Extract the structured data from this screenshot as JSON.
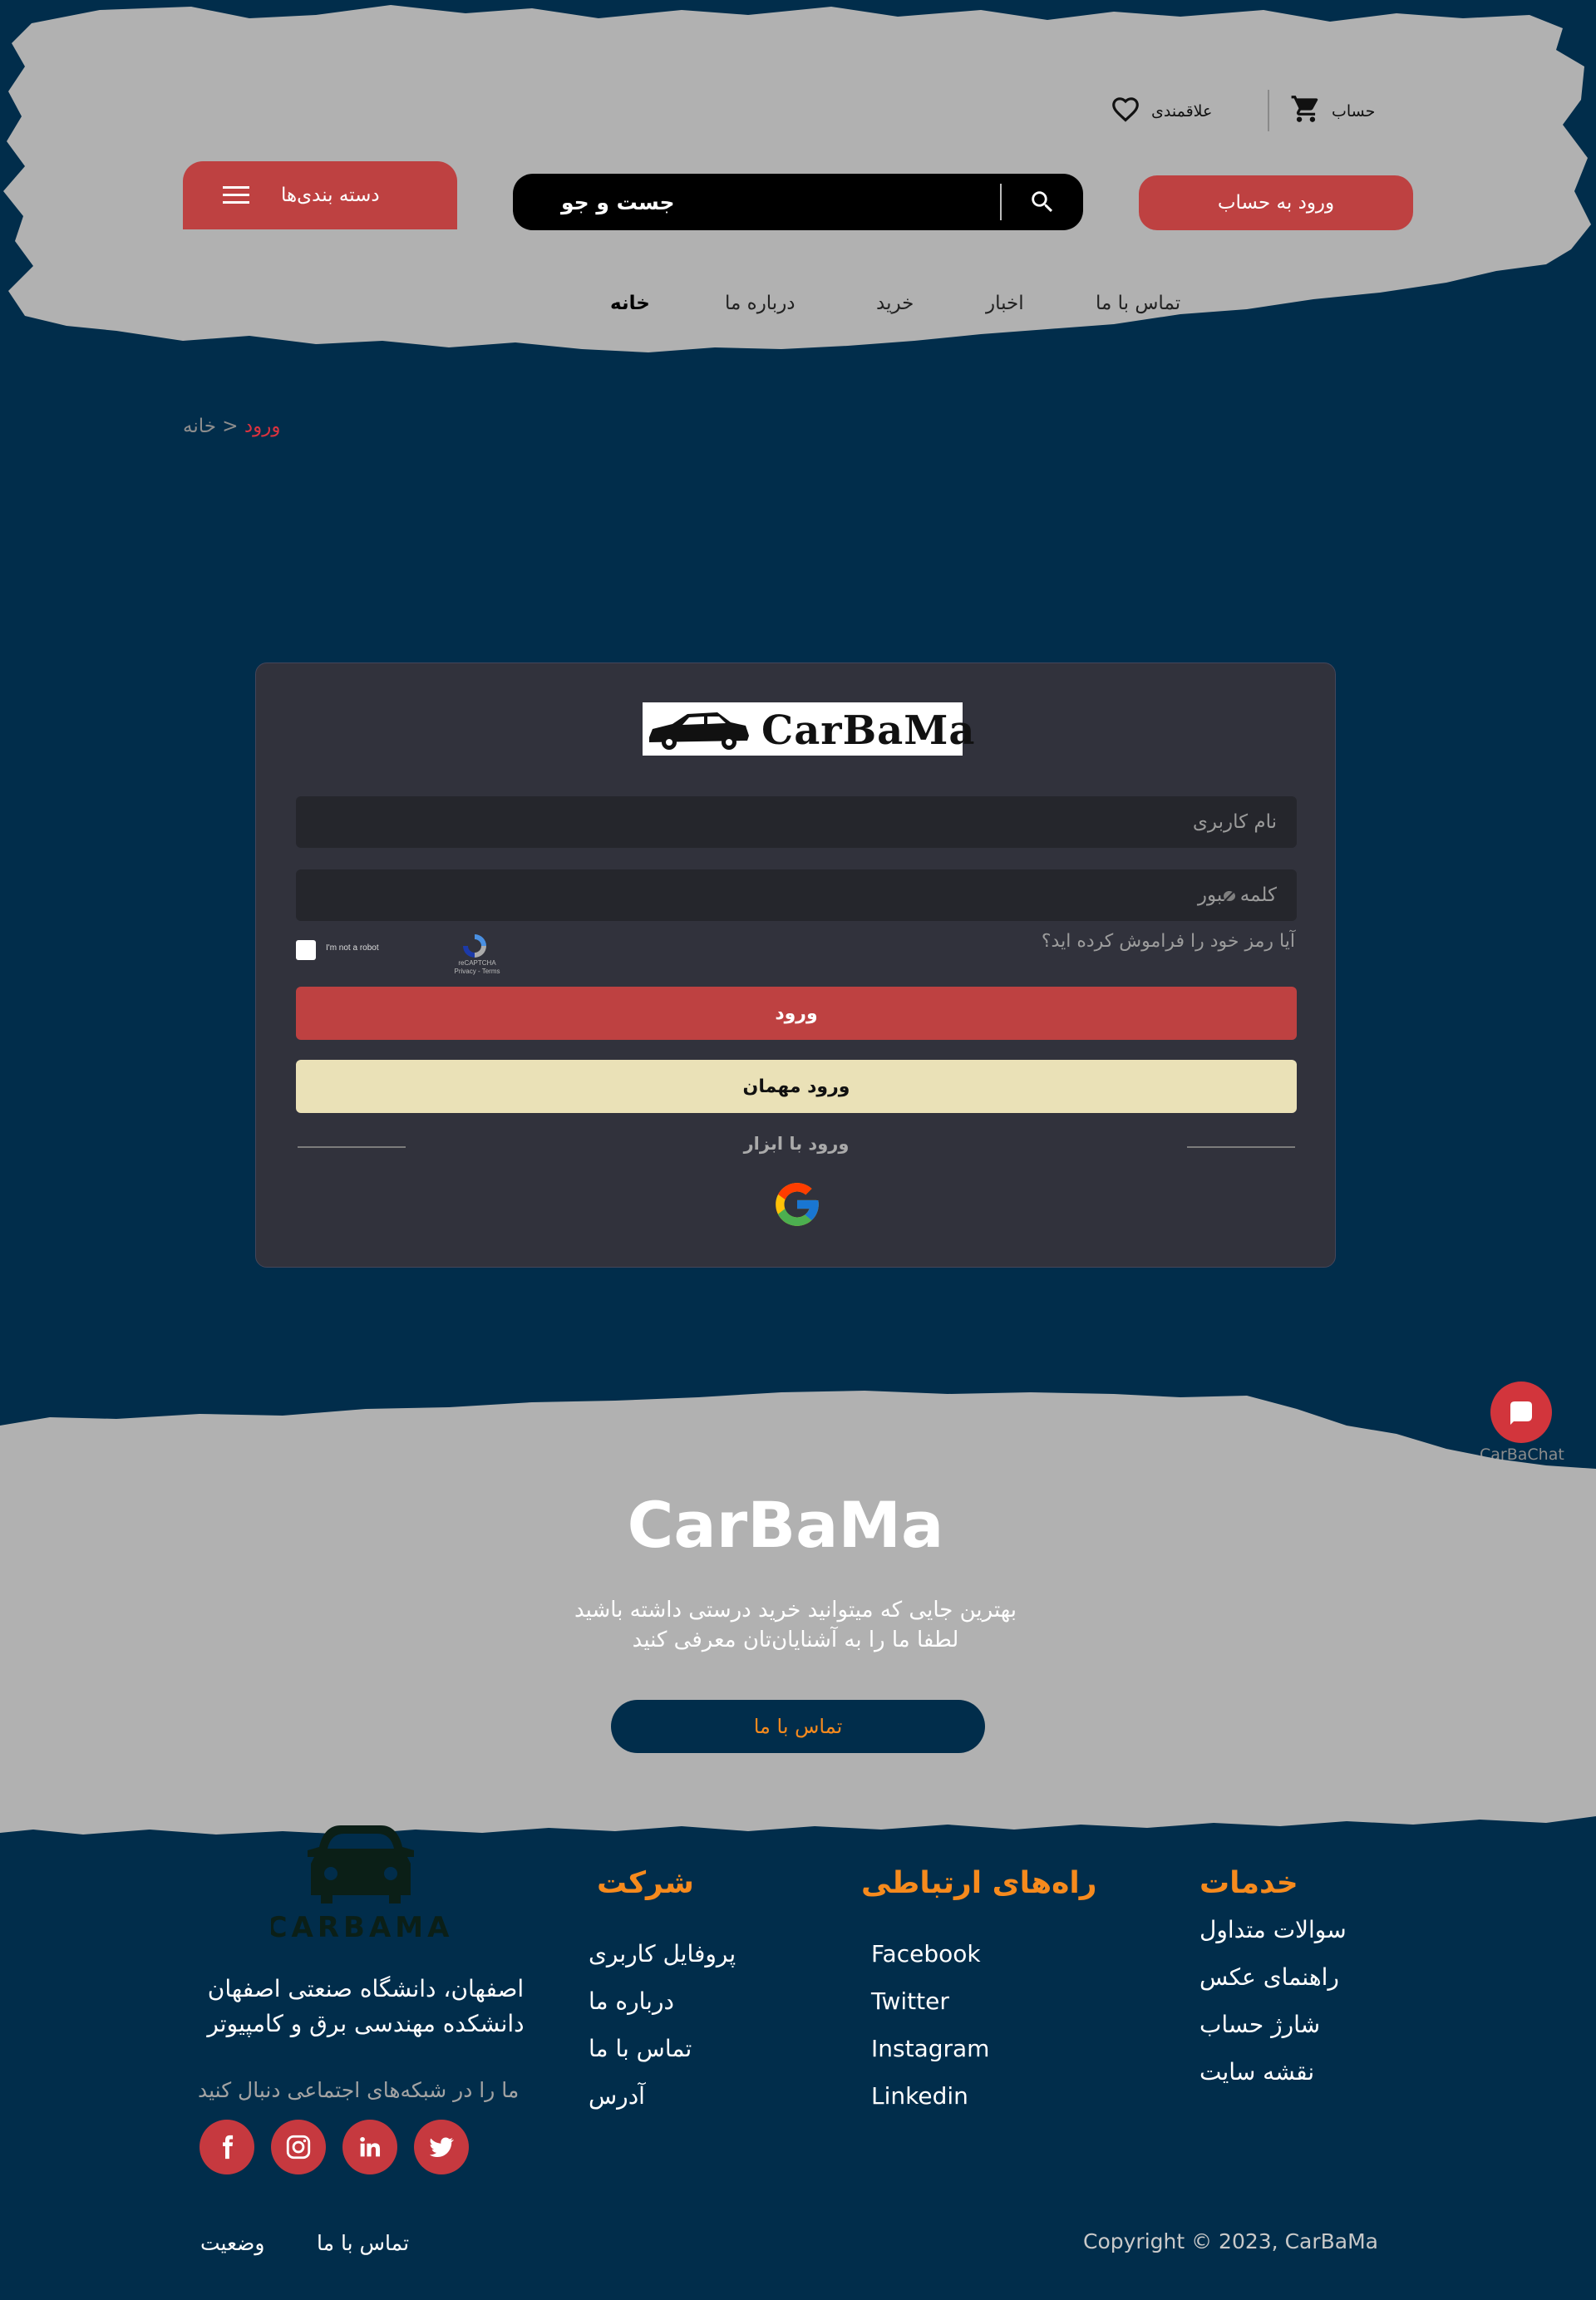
{
  "header": {
    "account_label": "حساب",
    "wishlist_label": "علاقمندی",
    "login_button": "ورود به حساب",
    "search_label": "جست و جو",
    "categories_button": "دسته بندی‌ها",
    "nav": {
      "home": "خانه",
      "about": "درباره ما",
      "shop": "خرید",
      "news": "اخبار",
      "contact": "تماس با ما"
    }
  },
  "breadcrumb": {
    "current": "ورود",
    "separator": " < ",
    "home": "خانه"
  },
  "login_card": {
    "logo_text": "CarBaMa",
    "username_placeholder": "نام کاربری",
    "password_placeholder": "کلمه عبور",
    "captcha_label": "I'm not a robot",
    "recaptcha_label": "reCAPTCHA",
    "recaptcha_terms": "Privacy - Terms",
    "forgot_password": "آیا رمز خود را فراموش کرده اید؟",
    "submit_button": "ورود",
    "guest_button": "ورود مهمان",
    "social_login_label": "ورود با ابزار"
  },
  "chat": {
    "label": "CarBaChat"
  },
  "footer_cta": {
    "title": "CarBaMa",
    "line1": "بهترین جایی که میتوانید خرید درستی داشته باشید",
    "line2": "لطفا ما را به آشنایان‌تان معرفی کنید",
    "contact_button": "تماس با ما"
  },
  "footer": {
    "logo_text": "CARBAMA",
    "address_line1": "اصفهان، دانشگاه صنعتی اصفهان",
    "address_line2": "دانشکده مهندسی برق و کامپیوتر",
    "follow_label": "ما را در شبکه‌های اجتماعی دنبال کنید",
    "company": {
      "title": "شرکت",
      "links": [
        "پروفایل کاربری",
        "درباره ما",
        "تماس با ما",
        "آدرس"
      ]
    },
    "contact": {
      "title": "راه‌های ارتباطی",
      "links": [
        "Facebook",
        "Twitter",
        "Instagram",
        "Linkedin"
      ]
    },
    "services": {
      "title": "خدمات",
      "links": [
        "سوالات متداول",
        "راهنمای عکس",
        "شارژ حساب",
        "نقشه سایت"
      ]
    },
    "bottom_links": {
      "status": "وضعیت",
      "contact": "تماس با ما"
    },
    "copyright": "Copyright © 2023, CarBaMa"
  },
  "colors": {
    "background": "#012d4b",
    "paper": "#b1b1b1",
    "accent_red": "#be4141",
    "accent_orange": "#f68a1d",
    "guest_button": "#eae1b7"
  }
}
